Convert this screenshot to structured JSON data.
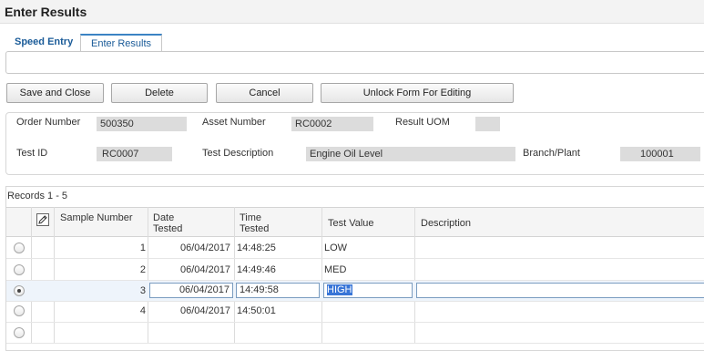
{
  "window": {
    "title": "Enter Results"
  },
  "tabs": [
    {
      "label": "Speed Entry",
      "active": false
    },
    {
      "label": "Enter Results",
      "active": true
    }
  ],
  "toolbar": {
    "save_close": "Save and Close",
    "delete": "Delete",
    "cancel": "Cancel",
    "unlock": "Unlock Form For Editing"
  },
  "form": {
    "order_number": {
      "label": "Order Number",
      "value": "500350"
    },
    "asset_number": {
      "label": "Asset Number",
      "value": "RC0002"
    },
    "result_uom": {
      "label": "Result UOM",
      "value": ""
    },
    "test_id": {
      "label": "Test ID",
      "value": "RC0007"
    },
    "test_description": {
      "label": "Test Description",
      "value": "Engine Oil Level"
    },
    "branch_plant": {
      "label": "Branch/Plant",
      "value": "100001"
    }
  },
  "grid": {
    "records_label": "Records 1 - 5",
    "columns": {
      "sample_number": "Sample Number",
      "date_tested": "Date Tested",
      "time_tested": "Time Tested",
      "test_value": "Test Value",
      "description": "Description"
    },
    "rows": [
      {
        "sample": "1",
        "date": "06/04/2017",
        "time": "14:48:25",
        "value": "LOW",
        "description": "",
        "selected": false
      },
      {
        "sample": "2",
        "date": "06/04/2017",
        "time": "14:49:46",
        "value": "MED",
        "description": "",
        "selected": false
      },
      {
        "sample": "3",
        "date": "06/04/2017",
        "time": "14:49:58",
        "value": "HIGH",
        "description": "",
        "selected": true
      },
      {
        "sample": "4",
        "date": "06/04/2017",
        "time": "14:50:01",
        "value": "",
        "description": "",
        "selected": false
      },
      {
        "sample": "",
        "date": "",
        "time": "",
        "value": "",
        "description": "",
        "selected": false
      }
    ]
  },
  "icons": {
    "edit_column": "pencil-edit-icon"
  },
  "colors": {
    "accent": "#3b83c4",
    "link": "#1a5b98",
    "highlight": "#3875d7"
  }
}
